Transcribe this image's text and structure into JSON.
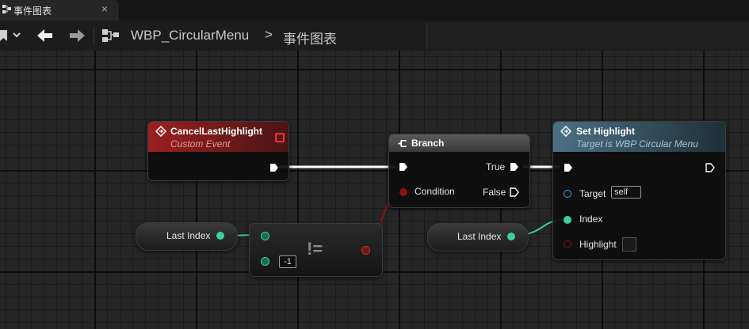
{
  "tab": {
    "label": "事件图表",
    "close": "×"
  },
  "breadcrumb": {
    "blueprint": "WBP_CircularMenu",
    "separator": ">",
    "graph": "事件图表"
  },
  "nodes": {
    "custom_event": {
      "title": "CancelLastHighlight",
      "subtitle": "Custom Event",
      "header_color": "#8c1c1c",
      "subtitle_color": "#e79a9a"
    },
    "branch": {
      "title": "Branch",
      "condition_label": "Condition",
      "true_label": "True",
      "false_label": "False"
    },
    "not_equal": {
      "symbol": "!=",
      "literal_value": "-1"
    },
    "set_highlight": {
      "title": "Set Highlight",
      "subtitle": "Target is WBP Circular Menu",
      "header_color": "#456b80",
      "subtitle_color": "#aac2d1",
      "target_label": "Target",
      "target_value": "self",
      "index_label": "Index",
      "highlight_label": "Highlight"
    },
    "last_index_1": {
      "label": "Last Index"
    },
    "last_index_2": {
      "label": "Last Index"
    }
  },
  "colors": {
    "integer_pin": "#3ccfa6",
    "bool_pin": "#8d1010",
    "object_pin": "#33a8e8",
    "exec_pin": "#ffffff"
  }
}
